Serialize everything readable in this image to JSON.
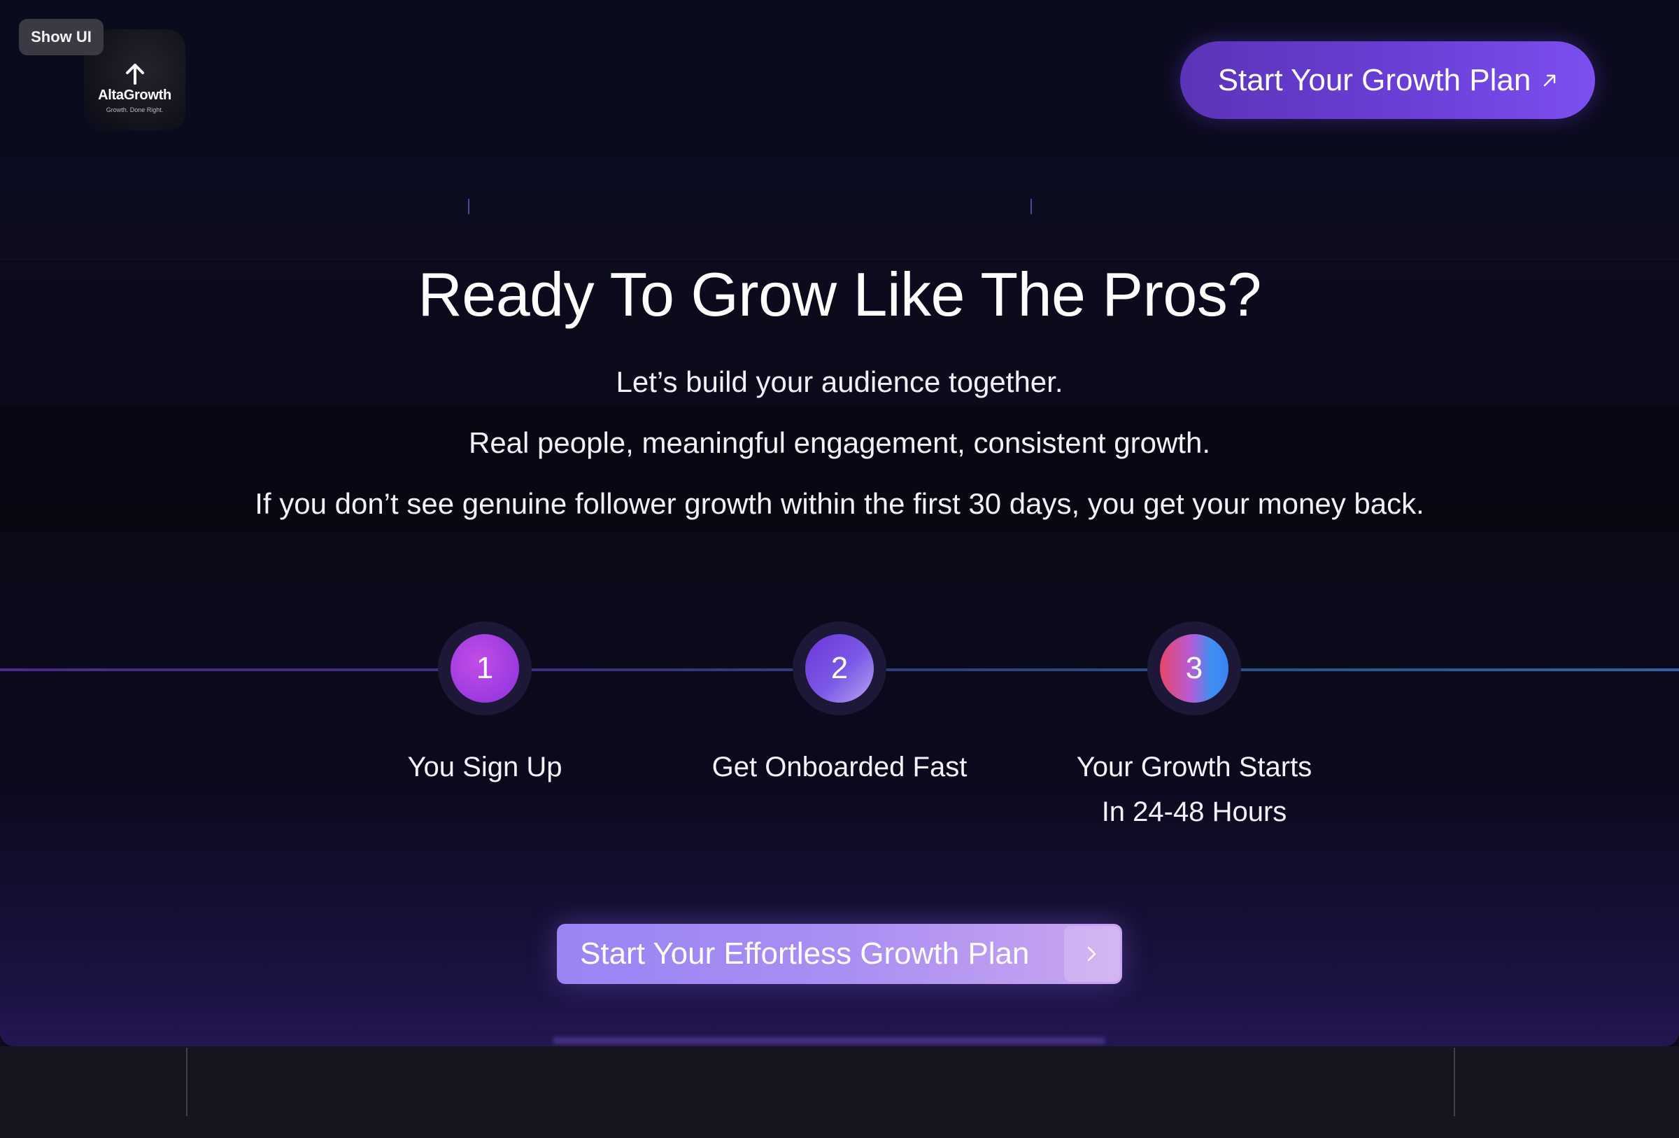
{
  "overlay": {
    "show_ui_label": "Show UI"
  },
  "brand": {
    "name": "AltaGrowth",
    "tagline": "Growth. Done Right."
  },
  "header": {
    "cta_label": "Start Your Growth Plan",
    "cta_icon": "arrow-up-right-icon"
  },
  "hero": {
    "title": "Ready To Grow Like The Pros?",
    "lines": [
      "Let’s build your audience together.",
      "Real people, meaningful engagement, consistent growth.",
      "If you don’t see genuine follower growth within the first 30 days, you get your money back."
    ]
  },
  "steps": [
    {
      "number": "1",
      "label_line1": "You Sign Up",
      "label_line2": ""
    },
    {
      "number": "2",
      "label_line1": "Get Onboarded Fast",
      "label_line2": ""
    },
    {
      "number": "3",
      "label_line1": "Your Growth Starts",
      "label_line2": "In 24-48 Hours"
    }
  ],
  "main_cta": {
    "label": "Start Your Effortless Growth Plan",
    "icon": "chevron-right-icon"
  },
  "colors": {
    "background": "#0b0b1c",
    "accent": "#6a3fd6",
    "cta_gradient_start": "#9a84f4",
    "cta_gradient_end": "#c9a6f0"
  }
}
